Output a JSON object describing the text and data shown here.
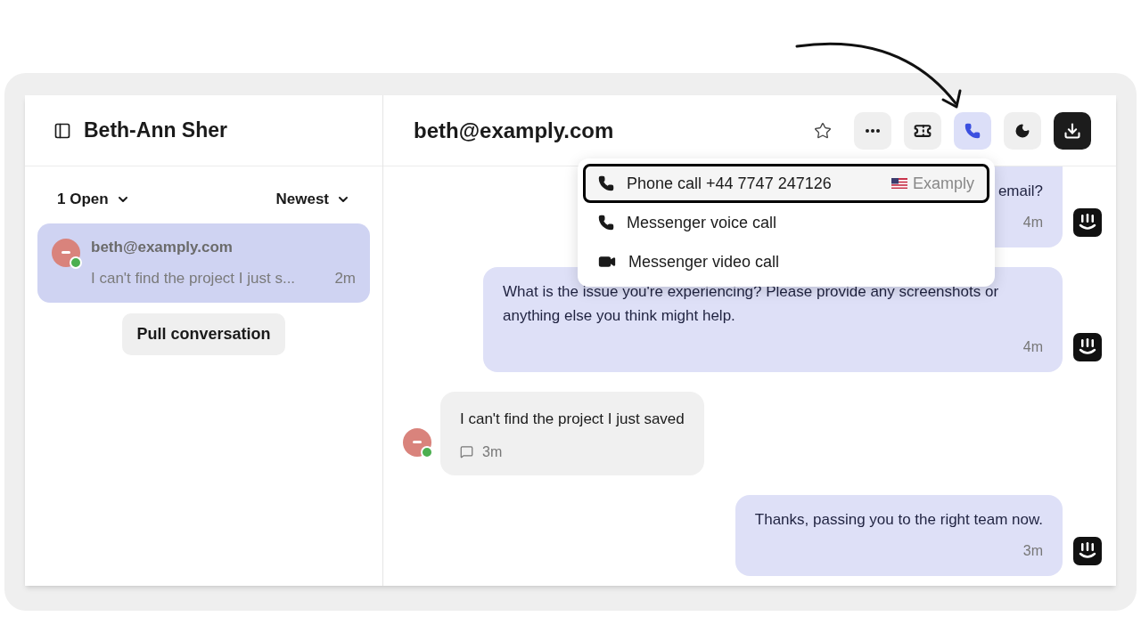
{
  "sidebar": {
    "title": "Beth-Ann Sher",
    "filters": [
      {
        "label": "1 Open"
      },
      {
        "label": "Newest"
      }
    ],
    "conversations": [
      {
        "name": "beth@examply.com",
        "preview": "I can't find the project I just s...",
        "time": "2m",
        "selected": true,
        "online": true
      }
    ],
    "pull_button": "Pull conversation"
  },
  "conversation": {
    "title": "beth@examply.com",
    "actions": [
      {
        "kind": "star",
        "selected": false
      },
      {
        "kind": "more",
        "selected": false
      },
      {
        "kind": "ticket",
        "selected": false
      },
      {
        "kind": "phone",
        "selected": true
      },
      {
        "kind": "snooze",
        "selected": false
      },
      {
        "kind": "download",
        "selected": false
      }
    ],
    "call_menu": [
      {
        "kind": "phone",
        "label": "Phone call +44 7747 247126",
        "workspace": "Examply",
        "selected": true
      },
      {
        "kind": "phone",
        "label": "Messenger voice call",
        "selected": false
      },
      {
        "kind": "video",
        "label": "Messenger video call",
        "selected": false
      }
    ],
    "messages": [
      {
        "kind": "agent",
        "text": "email?",
        "time": "4m"
      },
      {
        "kind": "agent",
        "text": "What is the issue you're experiencing? Please provide any screenshots or anything else you think might help.",
        "time": "4m"
      },
      {
        "kind": "customer",
        "text": "I can't find the project I just saved",
        "time": "3m"
      },
      {
        "kind": "agent",
        "text": "Thanks, passing you to the right team now.",
        "time": "3m"
      }
    ]
  }
}
